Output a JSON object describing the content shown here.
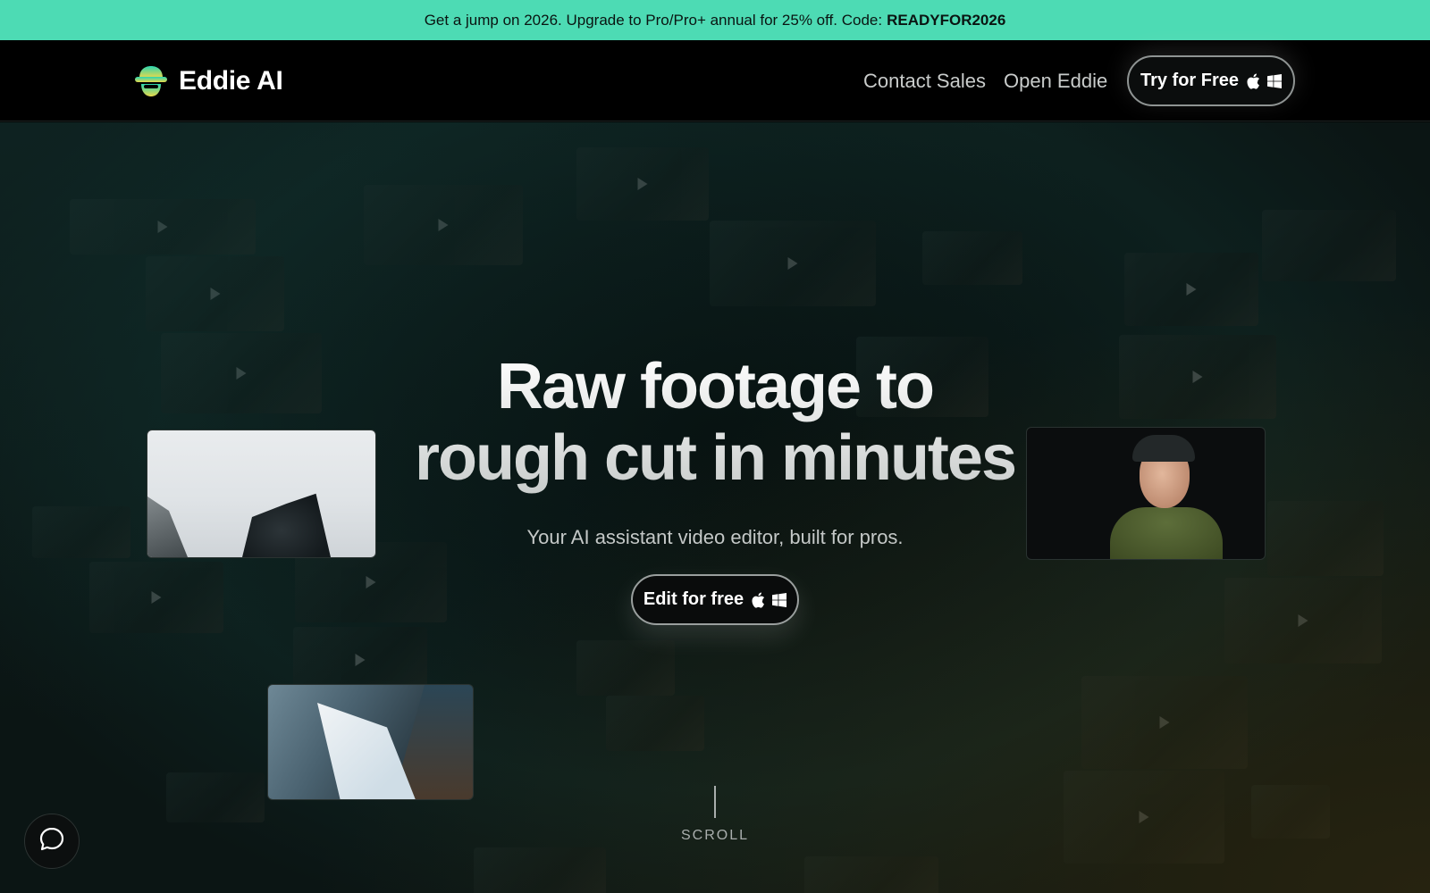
{
  "promo": {
    "text": "Get a jump on 2026. Upgrade to Pro/Pro+ annual for 25% off. Code:",
    "code": "READYFOR2026"
  },
  "nav": {
    "brand": "Eddie AI",
    "links": {
      "contact_sales": "Contact Sales",
      "open_eddie": "Open Eddie"
    },
    "cta": "Try for Free"
  },
  "hero": {
    "title_line1": "Raw footage to",
    "title_line2": "rough cut in minutes",
    "subtitle": "Your AI assistant video editor, built for pros.",
    "cta": "Edit for free",
    "scroll": "SCROLL"
  },
  "icons": {
    "logo": "eddie-logo-icon",
    "apple": "apple-icon",
    "windows": "windows-icon",
    "chat": "chat-bubble-icon",
    "play": "play-icon"
  },
  "colors": {
    "promo_bg": "#4ddbb4",
    "nav_bg": "#000000",
    "brand_teal": "#2bd6b0",
    "brand_yellow": "#e9d84a"
  }
}
